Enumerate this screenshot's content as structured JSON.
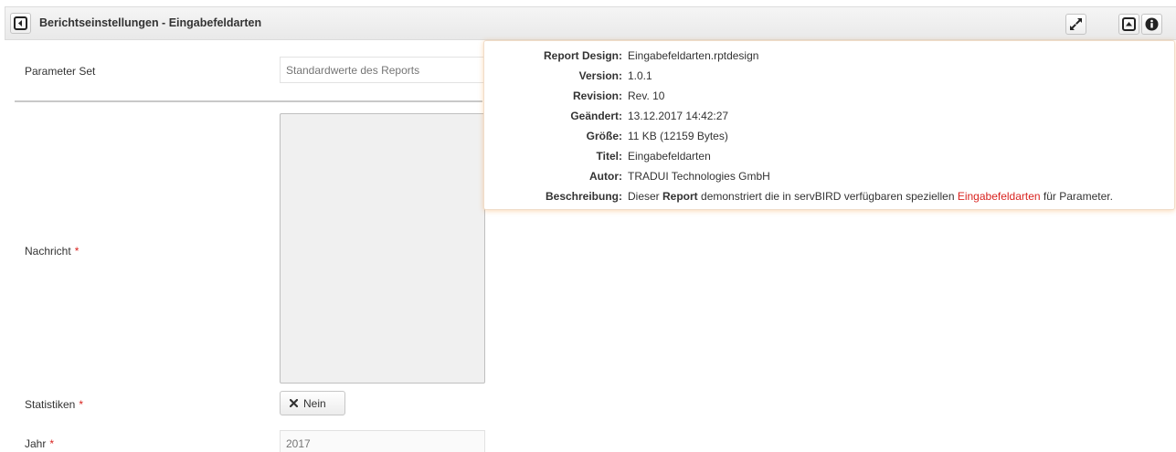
{
  "header": {
    "title": "Berichtseinstellungen - Eingabefeldarten",
    "icons": {
      "back": "collapse-left-icon",
      "expand": "expand-arrows-icon",
      "collapse": "collapse-up-icon",
      "info": "info-icon"
    }
  },
  "form": {
    "parameter_set": {
      "label": "Parameter Set",
      "placeholder": "Standardwerte des Reports"
    },
    "nachricht": {
      "label": "Nachricht",
      "required_mark": "*"
    },
    "statistiken": {
      "label": "Statistiken",
      "required_mark": "*",
      "toggle_icon": "x-mark-icon",
      "toggle_label": "Nein"
    },
    "jahr": {
      "label": "Jahr",
      "required_mark": "*",
      "placeholder": "2017"
    }
  },
  "info_popover": {
    "rows": [
      {
        "key": "Report Design:",
        "value": "Eingabefeldarten.rptdesign"
      },
      {
        "key": "Version:",
        "value": "1.0.1"
      },
      {
        "key": "Revision:",
        "value": "Rev. 10"
      },
      {
        "key": "Geändert:",
        "value": "13.12.2017 14:42:27"
      },
      {
        "key": "Größe:",
        "value": "11 KB (12159 Bytes)"
      },
      {
        "key": "Titel:",
        "value": "Eingabefeldarten"
      },
      {
        "key": "Autor:",
        "value": "TRADUI Technologies GmbH"
      }
    ],
    "description": {
      "key": "Beschreibung:",
      "part1": "Dieser ",
      "bold": "Report",
      "part2": " demonstriert die in servBIRD verfügbaren speziellen ",
      "highlight": "Eingabefeldarten",
      "part3": " für Parameter."
    }
  },
  "colors": {
    "required": "#d9231f",
    "highlight": "#d9231f",
    "popover_glow": "#f08c28"
  }
}
